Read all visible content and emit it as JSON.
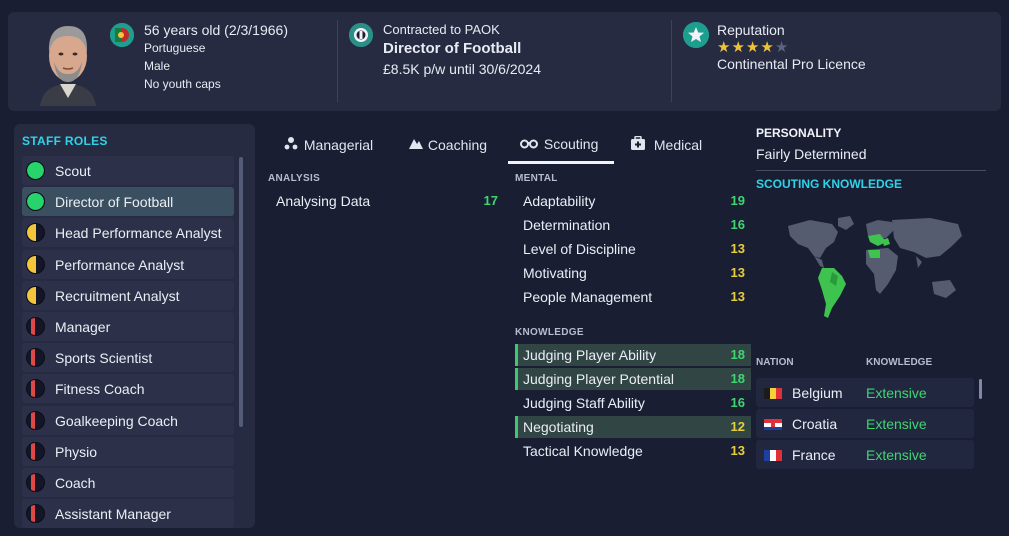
{
  "header": {
    "age_line": "56 years old (2/3/1966)",
    "nationality": "Portuguese",
    "gender": "Male",
    "youth_caps": "No youth caps",
    "contract_label": "Contracted to PAOK",
    "job_title": "Director of Football",
    "wage": "£8.5K p/w until 30/6/2024",
    "reputation_label": "Reputation",
    "reputation_stars": 4,
    "reputation_max_stars": 5,
    "licence": "Continental Pro Licence"
  },
  "staff_roles": {
    "title": "STAFF ROLES",
    "items": [
      {
        "label": "Scout",
        "suitability": "full",
        "color": "#27d36a"
      },
      {
        "label": "Director of Football",
        "suitability": "full",
        "color": "#27d36a",
        "selected": true
      },
      {
        "label": "Head Performance Analyst",
        "suitability": "half",
        "color": "#f2c53d"
      },
      {
        "label": "Performance Analyst",
        "suitability": "half",
        "color": "#f2c53d"
      },
      {
        "label": "Recruitment Analyst",
        "suitability": "half",
        "color": "#f2c53d"
      },
      {
        "label": "Manager",
        "suitability": "low",
        "color": "#e04848"
      },
      {
        "label": "Sports Scientist",
        "suitability": "low",
        "color": "#e04848"
      },
      {
        "label": "Fitness Coach",
        "suitability": "low",
        "color": "#e04848"
      },
      {
        "label": "Goalkeeping Coach",
        "suitability": "low",
        "color": "#e04848"
      },
      {
        "label": "Physio",
        "suitability": "low",
        "color": "#e04848"
      },
      {
        "label": "Coach",
        "suitability": "low",
        "color": "#e04848"
      },
      {
        "label": "Assistant Manager",
        "suitability": "low",
        "color": "#e04848"
      }
    ]
  },
  "tabs": [
    {
      "label": "Managerial",
      "icon": "managerial-icon"
    },
    {
      "label": "Coaching",
      "icon": "coaching-icon"
    },
    {
      "label": "Scouting",
      "icon": "binoculars-icon",
      "active": true
    },
    {
      "label": "Medical",
      "icon": "medical-kit-icon"
    }
  ],
  "analysis": {
    "heading": "ANALYSIS",
    "items": [
      {
        "name": "Analysing Data",
        "value": "17"
      }
    ]
  },
  "mental": {
    "heading": "MENTAL",
    "items": [
      {
        "name": "Adaptability",
        "value": "19"
      },
      {
        "name": "Determination",
        "value": "16"
      },
      {
        "name": "Level of Discipline",
        "value": "13"
      },
      {
        "name": "Motivating",
        "value": "13"
      },
      {
        "name": "People Management",
        "value": "13"
      }
    ]
  },
  "knowledge": {
    "heading": "KNOWLEDGE",
    "items": [
      {
        "name": "Judging Player Ability",
        "value": "18",
        "highlighted": true
      },
      {
        "name": "Judging Player Potential",
        "value": "18",
        "highlighted": true
      },
      {
        "name": "Judging Staff Ability",
        "value": "16"
      },
      {
        "name": "Negotiating",
        "value": "12",
        "highlighted": true
      },
      {
        "name": "Tactical Knowledge",
        "value": "13"
      }
    ]
  },
  "personality": {
    "heading": "PERSONALITY",
    "value": "Fairly Determined"
  },
  "scouting_knowledge": {
    "heading": "SCOUTING KNOWLEDGE",
    "col_nation": "NATION",
    "col_knowledge": "KNOWLEDGE",
    "nations": [
      {
        "name": "Belgium",
        "knowledge": "Extensive",
        "flag": "belgium-flag-icon"
      },
      {
        "name": "Croatia",
        "knowledge": "Extensive",
        "flag": "croatia-flag-icon"
      },
      {
        "name": "France",
        "knowledge": "Extensive",
        "flag": "france-flag-icon"
      }
    ]
  },
  "colors": {
    "accent_cyan": "#2fd3e8",
    "good_green": "#3fd670",
    "mid_yellow": "#e7cf3a",
    "panel_bg": "#262b42",
    "page_bg": "#1a1e33"
  }
}
